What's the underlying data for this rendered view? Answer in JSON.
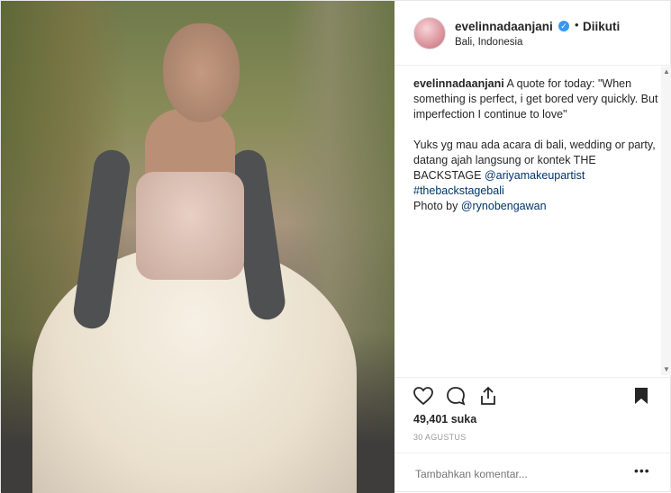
{
  "post": {
    "username": "evelinnadaanjani",
    "follow_status": "Diikuti",
    "separator": "•",
    "location": "Bali, Indonesia",
    "verified_mark": "✓",
    "caption": {
      "username": "evelinnadaanjani",
      "line1": "A quote for today: \"When something is perfect, i get bored very quickly. But imperfection I continue to love\"",
      "line2_text": "Yuks yg mau ada acara di bali, wedding or party, datang ajah langsung or kontek THE BACKSTAGE ",
      "mention1": "@ariyamakeupartist",
      "hashtag": "#thebackstagebali",
      "photo_by": "Photo by ",
      "mention2": "@rynobengawan"
    },
    "likes": "49,401 suka",
    "date": "30 AGUSTUS",
    "comment_placeholder": "Tambahkan komentar...",
    "more_label": "•••"
  },
  "icons": {
    "like": "heart-icon",
    "comment": "comment-icon",
    "share": "share-icon",
    "save": "bookmark-icon"
  },
  "colors": {
    "verified": "#3897f0",
    "link": "#003569",
    "text": "#262626"
  }
}
